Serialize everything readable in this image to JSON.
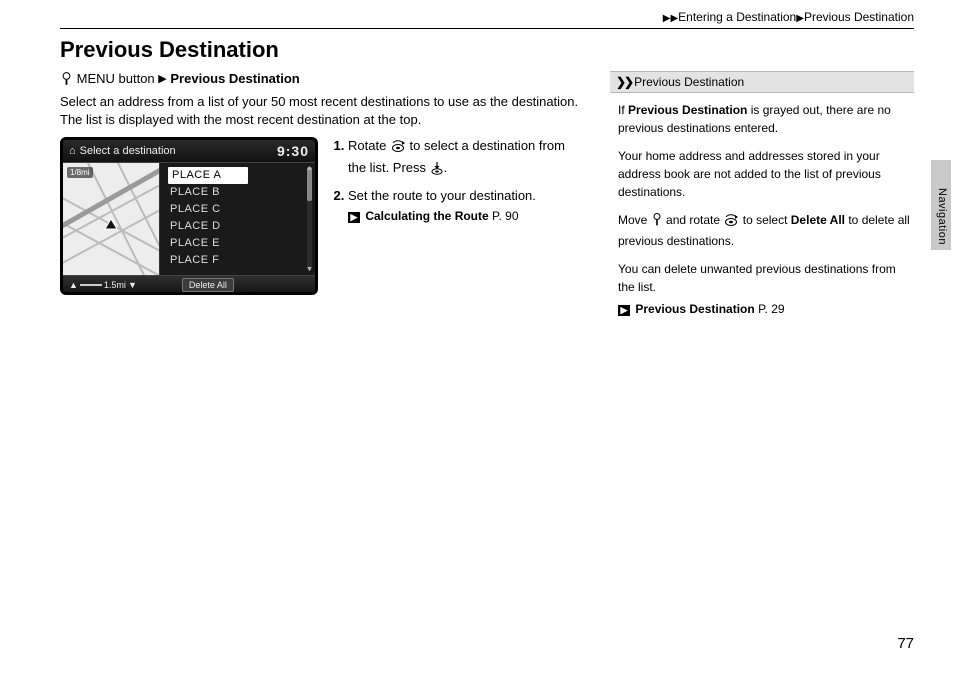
{
  "breadcrumb": {
    "level1": "Entering a Destination",
    "level2": "Previous Destination"
  },
  "title": "Previous Destination",
  "menu": {
    "button": "MENU button",
    "item": "Previous Destination"
  },
  "intro": "Select an address from a list of your 50 most recent destinations to use as the destination. The list is displayed with the most recent destination at the top.",
  "device": {
    "header": "Select a destination",
    "clock": "9:30",
    "map_tag": "1/8mi",
    "items": [
      "PLACE A",
      "PLACE B",
      "PLACE C",
      "PLACE D",
      "PLACE E",
      "PLACE F"
    ],
    "scale": "1.5mi",
    "delete": "Delete All"
  },
  "steps": {
    "s1a": "Rotate ",
    "s1b": " to select a destination from the list. Press ",
    "s1c": ".",
    "s2": "Set the route to your destination.",
    "ref_label": "Calculating the Route",
    "ref_page": "P. 90"
  },
  "info": {
    "head": "Previous Destination",
    "n1a": "If ",
    "n1b": "Previous Destination",
    "n1c": " is grayed out, there are no previous destinations entered.",
    "n2": "Your home address and addresses stored in your address book are not added to the list of previous destinations.",
    "n3a": "Move ",
    "n3b": " and rotate ",
    "n3c": " to select ",
    "n3d": "Delete All",
    "n3e": " to delete all previous destinations.",
    "n4": "You can delete unwanted previous destinations from the list.",
    "ref_label": "Previous Destination",
    "ref_page": "P. 29"
  },
  "tab": "Navigation",
  "page": "77"
}
